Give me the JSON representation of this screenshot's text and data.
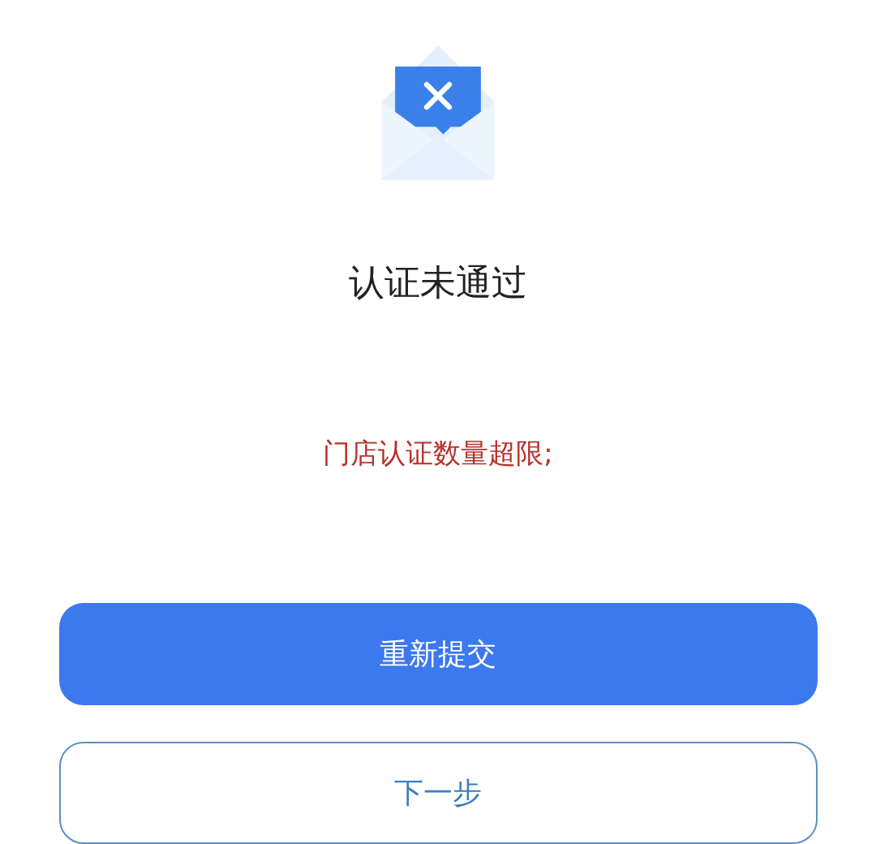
{
  "title": "认证未通过",
  "message": "门店认证数量超限;",
  "buttons": [
    {
      "label": "重新提交",
      "kind": "primary"
    },
    {
      "label": "下一步",
      "kind": "outline"
    }
  ]
}
